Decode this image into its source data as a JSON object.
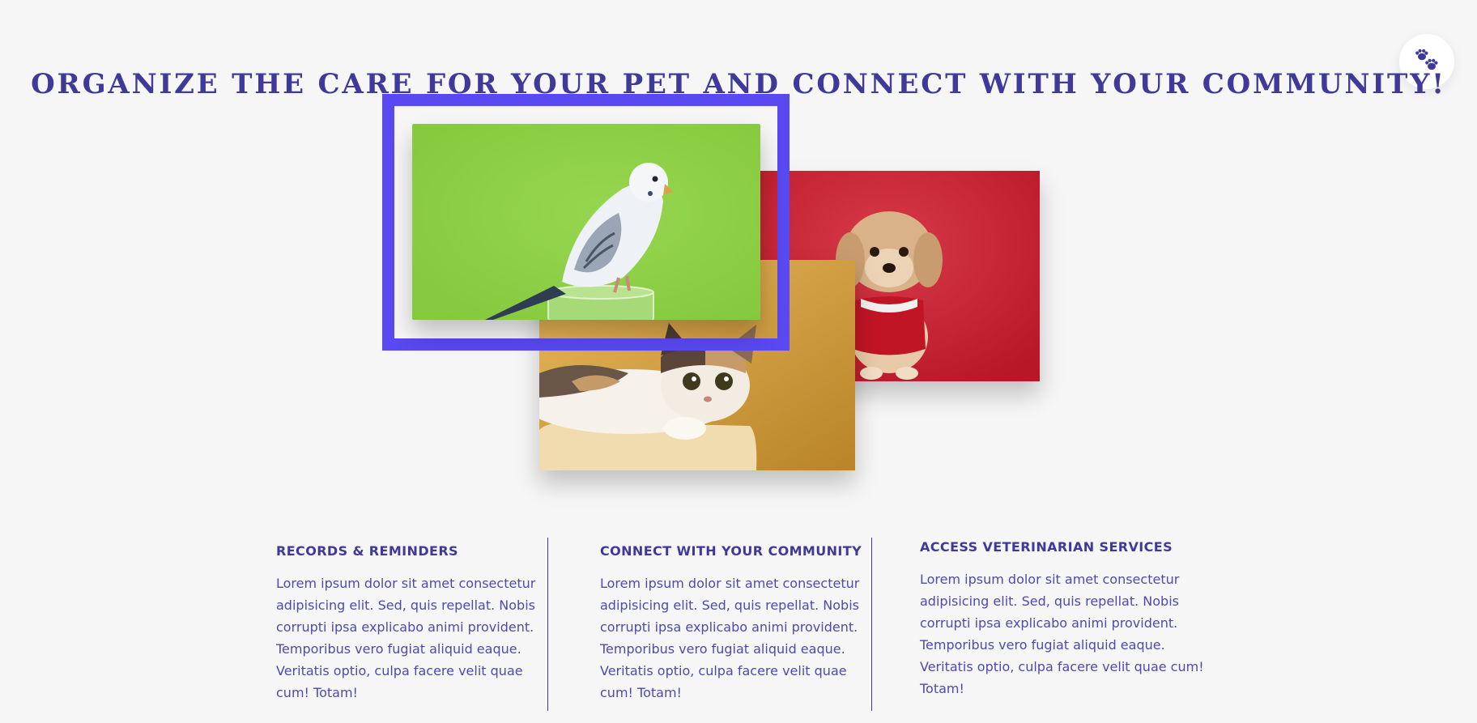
{
  "header": {
    "title": "ORGANIZE THE CARE FOR YOUR PET AND CONNECT WITH YOUR COMMUNITY!"
  },
  "paw_button": {
    "icon": "paw-icon",
    "accent_color": "#3f3a9a"
  },
  "gallery": {
    "highlight_color": "#5849f0",
    "photos": [
      {
        "name": "budgie",
        "background": "#8fd14a"
      },
      {
        "name": "dog",
        "background": "#cf2235"
      },
      {
        "name": "kitten",
        "background": "#d9a650"
      }
    ]
  },
  "features": [
    {
      "title": "RECORDS & REMINDERS",
      "body": "Lorem ipsum dolor sit amet consectetur adipisicing elit. Sed, quis repellat. Nobis corrupti ipsa explicabo animi provident. Temporibus vero fugiat aliquid eaque. Veritatis optio, culpa facere velit quae cum! Totam!"
    },
    {
      "title": "CONNECT WITH YOUR COMMUNITY",
      "body": "Lorem ipsum dolor sit amet consectetur adipisicing elit. Sed, quis repellat. Nobis corrupti ipsa explicabo animi provident. Temporibus vero fugiat aliquid eaque. Veritatis optio, culpa facere velit quae cum! Totam!"
    },
    {
      "title": "ACCESS VETERINARIAN SERVICES",
      "body": "Lorem ipsum dolor sit amet consectetur adipisicing elit. Sed, quis repellat. Nobis corrupti ipsa explicabo animi provident. Temporibus vero fugiat aliquid eaque. Veritatis optio, culpa facere velit quae cum! Totam!"
    }
  ],
  "colors": {
    "page_background": "#f6f6f6",
    "primary_text": "#3f3a9a"
  }
}
